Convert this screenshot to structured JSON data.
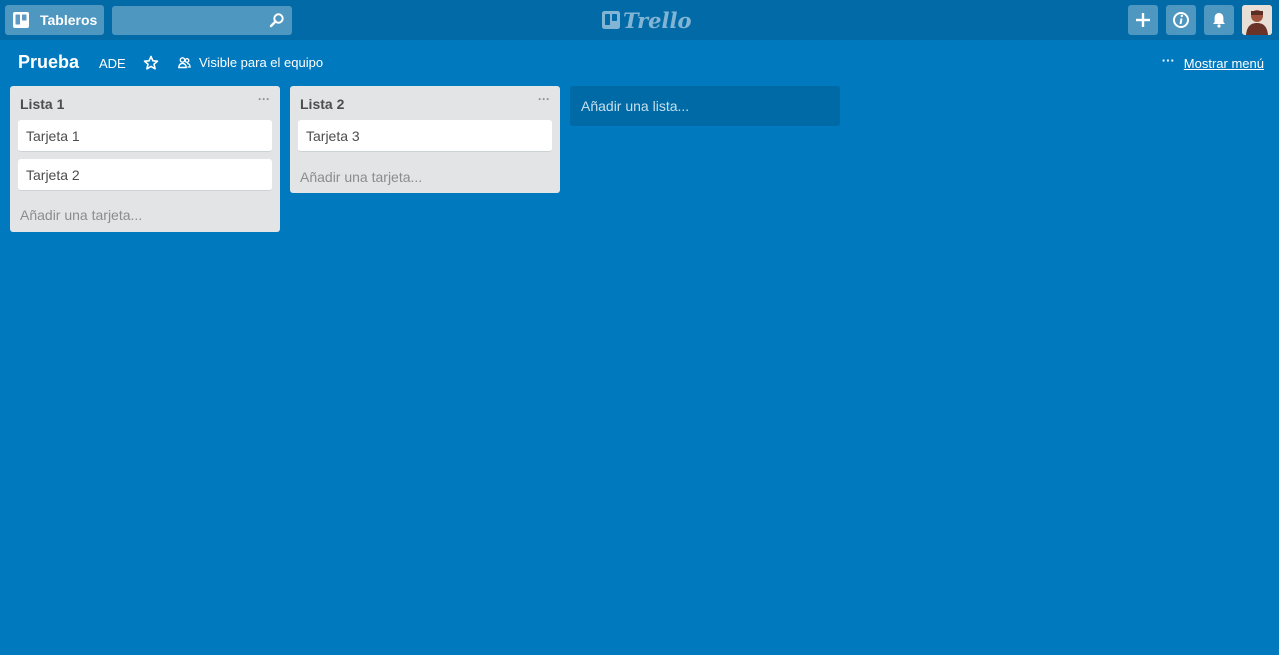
{
  "header": {
    "boards_label": "Tableros",
    "search_value": "",
    "logo_text": "Trello",
    "icons": {
      "boards": "boards-icon",
      "search": "search-icon",
      "add": "plus-icon",
      "info": "info-icon",
      "notifications": "bell-icon",
      "avatar": "user-avatar"
    }
  },
  "board": {
    "title": "Prueba",
    "team": "ADE",
    "visibility": "Visible para el equipo",
    "menu_label": "Mostrar menú"
  },
  "lists": [
    {
      "name": "Lista 1",
      "cards": [
        "Tarjeta 1",
        "Tarjeta 2"
      ],
      "add_card_label": "Añadir una tarjeta..."
    },
    {
      "name": "Lista 2",
      "cards": [
        "Tarjeta 3"
      ],
      "add_card_label": "Añadir una tarjeta..."
    }
  ],
  "add_list_label": "Añadir una lista...",
  "colors": {
    "board_background": "#0079bf",
    "header_background": "#026aa7",
    "list_background": "#e2e4e6",
    "card_background": "#ffffff"
  }
}
